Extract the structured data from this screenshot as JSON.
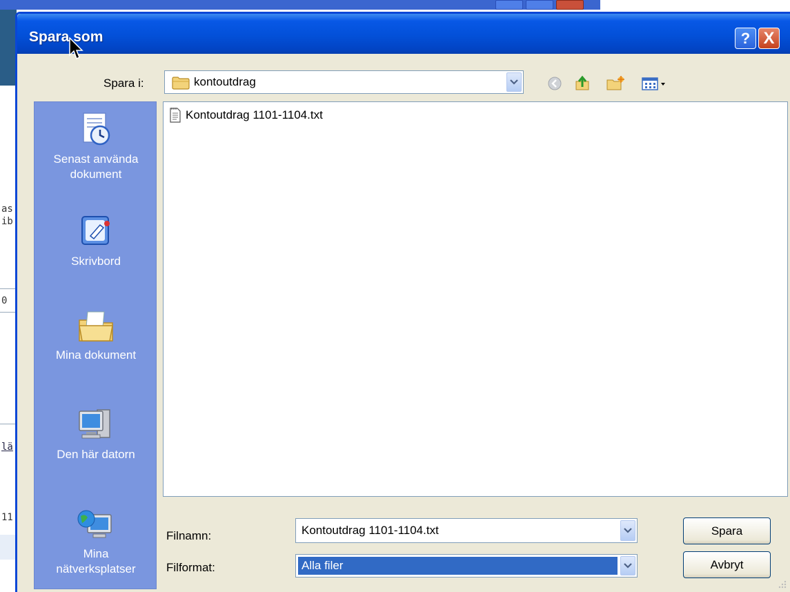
{
  "dialog": {
    "title": "Spara som",
    "help_label": "?",
    "close_label": "X"
  },
  "location": {
    "label": "Spara i:",
    "current_folder": "kontoutdrag"
  },
  "places": [
    {
      "label_line1": "Senast använda",
      "label_line2": "dokument",
      "icon": "recent-documents-icon"
    },
    {
      "label_line1": "Skrivbord",
      "label_line2": "",
      "icon": "desktop-icon"
    },
    {
      "label_line1": "Mina dokument",
      "label_line2": "",
      "icon": "my-documents-icon"
    },
    {
      "label_line1": "Den här datorn",
      "label_line2": "",
      "icon": "my-computer-icon"
    },
    {
      "label_line1": "Mina",
      "label_line2": "nätverksplatser",
      "icon": "network-places-icon"
    }
  ],
  "files": [
    {
      "name": "Kontoutdrag 1101-1104.txt",
      "icon": "text-file-icon"
    }
  ],
  "filename": {
    "label": "Filnamn:",
    "value": "Kontoutdrag 1101-1104.txt"
  },
  "filetype": {
    "label": "Filformat:",
    "value": "Alla filer"
  },
  "buttons": {
    "save": "Spara",
    "cancel": "Avbryt"
  },
  "background_fragments": [
    "as",
    "ib",
    "0",
    "lä",
    "11"
  ],
  "colors": {
    "title_bar": "#0350d8",
    "places_bar": "#7a96df",
    "selection": "#316ac5",
    "dialog_face": "#ece9d8"
  }
}
